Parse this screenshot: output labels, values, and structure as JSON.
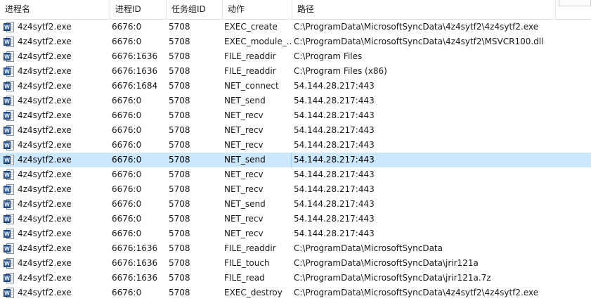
{
  "columns": {
    "name": "进程名",
    "pid": "进程ID",
    "tid": "任务组ID",
    "action": "动作",
    "path": "路径"
  },
  "rows": [
    {
      "name": "4z4sytf2.exe",
      "pid": "6676:0",
      "tid": "5708",
      "action": "EXEC_create",
      "path": "C:\\ProgramData\\MicrosoftSyncData\\4z4sytf2\\4z4sytf2.exe"
    },
    {
      "name": "4z4sytf2.exe",
      "pid": "6676:0",
      "tid": "5708",
      "action": "EXEC_module_...",
      "path": "C:\\ProgramData\\MicrosoftSyncData\\4z4sytf2\\MSVCR100.dll"
    },
    {
      "name": "4z4sytf2.exe",
      "pid": "6676:1636",
      "tid": "5708",
      "action": "FILE_readdir",
      "path": "C:\\Program Files"
    },
    {
      "name": "4z4sytf2.exe",
      "pid": "6676:1636",
      "tid": "5708",
      "action": "FILE_readdir",
      "path": "C:\\Program Files (x86)"
    },
    {
      "name": "4z4sytf2.exe",
      "pid": "6676:1684",
      "tid": "5708",
      "action": "NET_connect",
      "path": "54.144.28.217:443"
    },
    {
      "name": "4z4sytf2.exe",
      "pid": "6676:0",
      "tid": "5708",
      "action": "NET_send",
      "path": "54.144.28.217:443"
    },
    {
      "name": "4z4sytf2.exe",
      "pid": "6676:0",
      "tid": "5708",
      "action": "NET_recv",
      "path": "54.144.28.217:443"
    },
    {
      "name": "4z4sytf2.exe",
      "pid": "6676:0",
      "tid": "5708",
      "action": "NET_recv",
      "path": "54.144.28.217:443"
    },
    {
      "name": "4z4sytf2.exe",
      "pid": "6676:0",
      "tid": "5708",
      "action": "NET_recv",
      "path": "54.144.28.217:443"
    },
    {
      "name": "4z4sytf2.exe",
      "pid": "6676:0",
      "tid": "5708",
      "action": "NET_send",
      "path": "54.144.28.217:443",
      "selected": true
    },
    {
      "name": "4z4sytf2.exe",
      "pid": "6676:0",
      "tid": "5708",
      "action": "NET_recv",
      "path": "54.144.28.217:443"
    },
    {
      "name": "4z4sytf2.exe",
      "pid": "6676:0",
      "tid": "5708",
      "action": "NET_recv",
      "path": "54.144.28.217:443"
    },
    {
      "name": "4z4sytf2.exe",
      "pid": "6676:0",
      "tid": "5708",
      "action": "NET_send",
      "path": "54.144.28.217:443"
    },
    {
      "name": "4z4sytf2.exe",
      "pid": "6676:0",
      "tid": "5708",
      "action": "NET_recv",
      "path": "54.144.28.217:443"
    },
    {
      "name": "4z4sytf2.exe",
      "pid": "6676:0",
      "tid": "5708",
      "action": "NET_recv",
      "path": "54.144.28.217:443"
    },
    {
      "name": "4z4sytf2.exe",
      "pid": "6676:1636",
      "tid": "5708",
      "action": "FILE_readdir",
      "path": "C:\\ProgramData\\MicrosoftSyncData"
    },
    {
      "name": "4z4sytf2.exe",
      "pid": "6676:1636",
      "tid": "5708",
      "action": "FILE_touch",
      "path": "C:\\ProgramData\\MicrosoftSyncData\\jrir121a"
    },
    {
      "name": "4z4sytf2.exe",
      "pid": "6676:1636",
      "tid": "5708",
      "action": "FILE_read",
      "path": "C:\\ProgramData\\MicrosoftSyncData\\jrir121a.7z"
    },
    {
      "name": "4z4sytf2.exe",
      "pid": "6676:0",
      "tid": "5708",
      "action": "EXEC_destroy",
      "path": "C:\\ProgramData\\MicrosoftSyncData\\4z4sytf2\\4z4sytf2.exe"
    }
  ],
  "icon": {
    "name": "word-document-icon",
    "color": "#2b579a"
  },
  "selection_color": "#cce8ff"
}
